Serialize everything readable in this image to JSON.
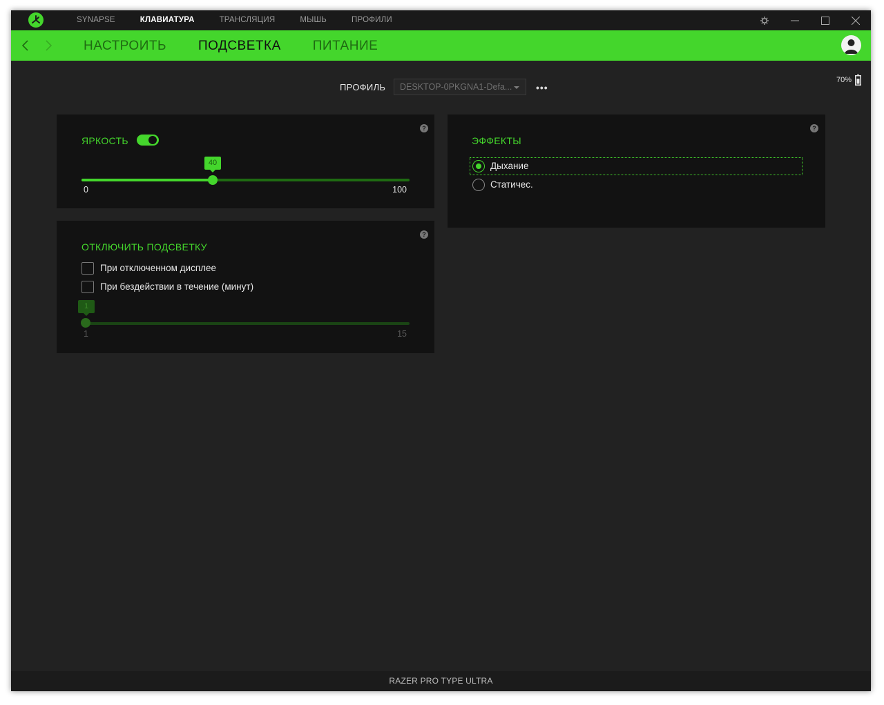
{
  "topnav": {
    "items": [
      {
        "label": "SYNAPSE",
        "active": false
      },
      {
        "label": "КЛАВИАТУРА",
        "active": true
      },
      {
        "label": "ТРАНСЛЯЦИЯ",
        "active": false
      },
      {
        "label": "МЫШЬ",
        "active": false
      },
      {
        "label": "ПРОФИЛИ",
        "active": false
      }
    ]
  },
  "subnav": {
    "items": [
      {
        "label": "НАСТРОИТЬ",
        "active": false
      },
      {
        "label": "ПОДСВЕТКА",
        "active": true
      },
      {
        "label": "ПИТАНИЕ",
        "active": false
      }
    ]
  },
  "profile": {
    "label": "ПРОФИЛЬ",
    "selected": "DESKTOP-0PKGNA1-Defa...",
    "more_label": "•••"
  },
  "battery": {
    "text": "70%",
    "level": 0.7
  },
  "brightness": {
    "title": "ЯРКОСТЬ",
    "enabled": true,
    "value": "40",
    "value_fraction": 0.4,
    "min_label": "0",
    "max_label": "100"
  },
  "lighting_off": {
    "title": "ОТКЛЮЧИТЬ ПОДСВЕТКУ",
    "option_display_off": "При отключенном дисплее",
    "option_idle": "При бездействии в течение (минут)",
    "slider_value": "1",
    "slider_min": "1",
    "slider_max": "15"
  },
  "effects": {
    "title": "ЭФФЕКТЫ",
    "option_breathing": "Дыхание",
    "option_static": "Статичес."
  },
  "help_glyph": "?",
  "footer": {
    "device_name": "RAZER PRO TYPE ULTRA"
  },
  "colors": {
    "accent": "#44d62c",
    "background": "#222222",
    "panel": "#121212"
  }
}
